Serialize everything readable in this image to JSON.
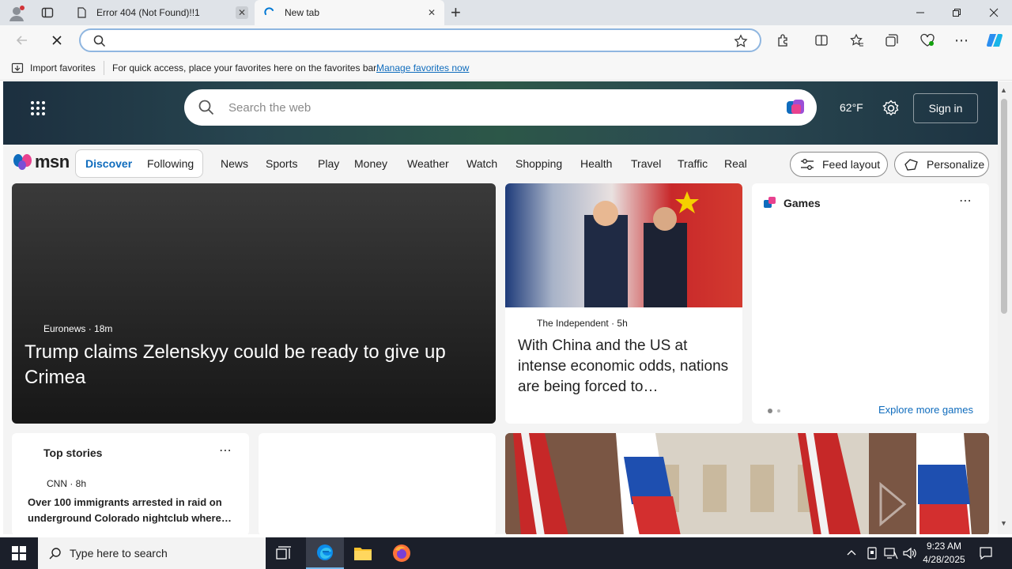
{
  "browser": {
    "tabs": [
      {
        "title": "Error 404 (Not Found)!!1",
        "active": false
      },
      {
        "title": "New tab",
        "active": true
      }
    ],
    "address_placeholder": "",
    "favorites_bar": {
      "import_label": "Import favorites",
      "message": "For quick access, place your favorites here on the favorites bar.",
      "manage_link": "Manage favorites now"
    }
  },
  "msn": {
    "search_placeholder": "Search the web",
    "weather": "62°F",
    "sign_in": "Sign in",
    "logo": "msn",
    "feed_tabs": [
      "Discover",
      "Following"
    ],
    "nav": [
      "News",
      "Sports",
      "Play",
      "Money",
      "Weather",
      "Watch",
      "Shopping",
      "Health",
      "Travel",
      "Traffic",
      "Real E"
    ],
    "feed_layout": "Feed layout",
    "personalize": "Personalize",
    "main_story": {
      "source": "Euronews",
      "time": "18m",
      "headline": "Trump claims Zelenskyy could be ready to give up Crimea"
    },
    "china_story": {
      "source": "The Independent",
      "time": "5h",
      "headline": "With China and the US at intense economic odds, nations are being forced to…"
    },
    "games": {
      "title": "Games",
      "more": "Explore more games",
      "page_dots": 2,
      "active_dot": 1
    },
    "top_stories": {
      "title": "Top stories",
      "source": "CNN",
      "time": "8h",
      "headline": "Over 100 immigrants arrested in raid on underground Colorado nightclub where…"
    }
  },
  "taskbar": {
    "search_placeholder": "Type here to search",
    "time": "9:23 AM",
    "date": "4/28/2025"
  },
  "colors": {
    "accent": "#0f6cbd",
    "edge_blue": "#0078d4",
    "taskbar": "#1b1f2a"
  }
}
